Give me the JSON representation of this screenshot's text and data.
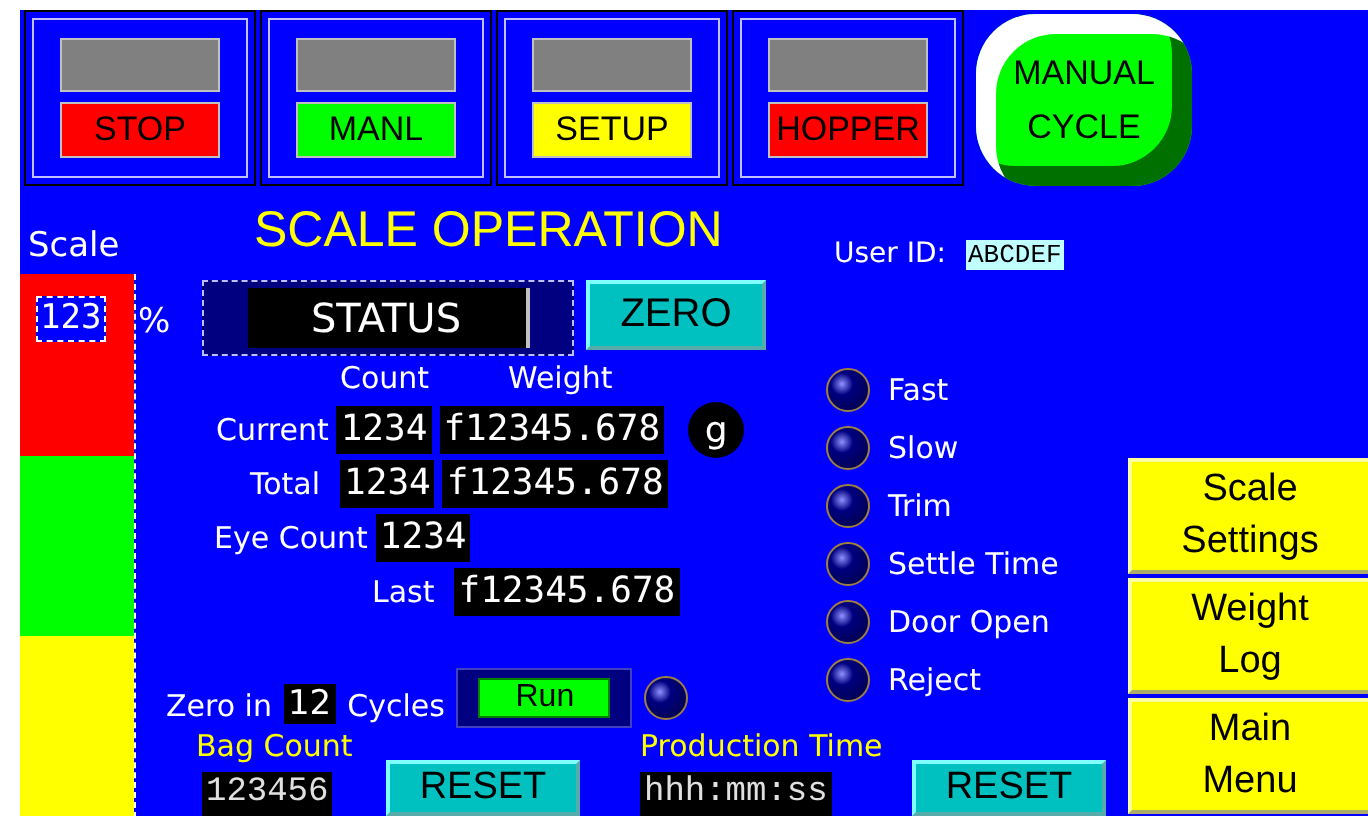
{
  "mode_buttons": [
    {
      "label": "STOP",
      "color": "#ff0000",
      "lamp_on": false
    },
    {
      "label": "MANL",
      "color": "#00ff00",
      "lamp_on": false
    },
    {
      "label": "SETUP",
      "color": "#ffff00",
      "lamp_on": false
    },
    {
      "label": "HOPPER",
      "color": "#ff0000",
      "lamp_on": false
    }
  ],
  "manual_cycle": {
    "label": "MANUAL CYCLE"
  },
  "title": "SCALE OPERATION",
  "scale": {
    "label": "Scale",
    "value": "123",
    "unit": "%",
    "zones": [
      {
        "color": "#ff0000"
      },
      {
        "color": "#00ff00"
      },
      {
        "color": "#ffff00"
      }
    ]
  },
  "status": "STATUS",
  "zero_button": "ZERO",
  "user_id": {
    "label": "User ID:",
    "value": "ABCDEF"
  },
  "columns": [
    "Count",
    "Weight"
  ],
  "rows": [
    {
      "label": "Current",
      "count": "1234",
      "weight": "f12345.678",
      "unit": "g"
    },
    {
      "label": "Total",
      "count": "1234",
      "weight": "f12345.678"
    },
    {
      "label": "Eye Count",
      "count": "1234"
    }
  ],
  "last": {
    "label": "Last",
    "weight": "f12345.678"
  },
  "indicators": [
    {
      "label": "Fast",
      "on": false
    },
    {
      "label": "Slow",
      "on": false
    },
    {
      "label": "Trim",
      "on": false
    },
    {
      "label": "Settle Time",
      "on": false
    },
    {
      "label": "Door Open",
      "on": false
    },
    {
      "label": "Reject",
      "on": false
    }
  ],
  "zero_in": {
    "prefix": "Zero in",
    "value": "12",
    "suffix": "Cycles",
    "run": "Run",
    "lamp_on": false
  },
  "bag_count": {
    "label": "Bag Count",
    "value": "123456",
    "reset": "RESET"
  },
  "production_time": {
    "label": "Production Time",
    "value": "hhh:mm:ss",
    "reset": "RESET"
  },
  "nav_buttons": [
    "Scale Settings",
    "Weight Log",
    "Main Menu"
  ]
}
